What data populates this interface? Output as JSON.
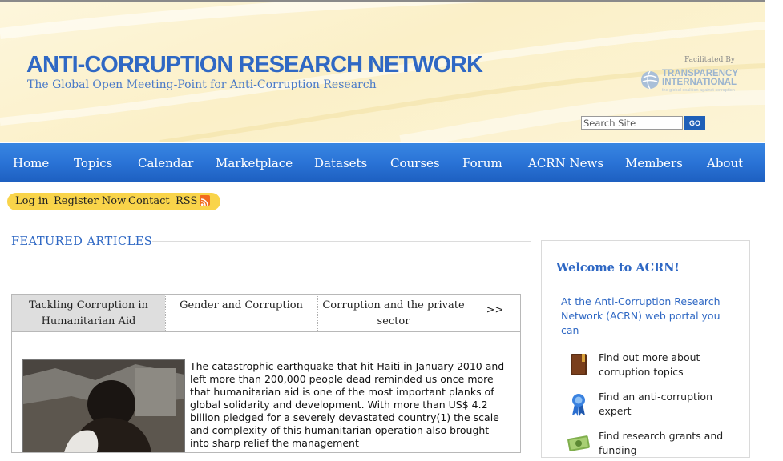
{
  "header": {
    "title": "ANTI-CORRUPTION RESEARCH NETWORK",
    "tagline": "The Global Open Meeting-Point for Anti-Corruption Research",
    "facilitated_by": "Facilitated By",
    "partner_logo": {
      "name_line1": "TRANSPARENCY",
      "name_line2": "INTERNATIONAL",
      "sub": "the global coalition against corruption"
    },
    "search": {
      "placeholder": "Search Site",
      "button_label": "GO"
    }
  },
  "nav": {
    "items": [
      "Home",
      "Topics",
      "Calendar",
      "Marketplace",
      "Datasets",
      "Courses",
      "Forum",
      "ACRN News",
      "Members",
      "About"
    ]
  },
  "userbar": {
    "links": [
      "Log in",
      "Register Now",
      "Contact",
      "RSS"
    ]
  },
  "featured": {
    "heading": "FEATURED ARTICLES",
    "tabs": [
      {
        "line1": "Tackling Corruption in",
        "line2": "Humanitarian Aid"
      },
      {
        "line1": "Gender and Corruption",
        "line2": ""
      },
      {
        "line1": "Corruption and the private",
        "line2": "sector"
      },
      {
        "line1": ">>",
        "line2": ""
      }
    ],
    "active_tab": 0,
    "article_text": "The catastrophic earthquake that hit Haiti in January 2010 and left more than 200,000 people dead reminded us once more that humanitarian aid is one of the most important planks of global solidarity and development. With more than US$ 4.2 billion pledged for a severely devastated country(1) the scale and complexity of this humanitarian operation also brought into sharp relief the management"
  },
  "sidebar": {
    "title": "Welcome to ACRN!",
    "intro": "At the Anti-Corruption Research Network (ACRN) web portal  you can -",
    "items": [
      {
        "label": "Find out more about corruption topics",
        "icon": "book-icon"
      },
      {
        "label": "Find an anti-corruption expert",
        "icon": "ribbon-award-icon"
      },
      {
        "label": "Find research grants and funding",
        "icon": "money-icon"
      }
    ]
  },
  "colors": {
    "brand_blue": "#2f68c4",
    "nav_blue": "#2a73d6",
    "userbar_yellow": "#f9d44a",
    "header_cream": "#fbf0c8"
  }
}
